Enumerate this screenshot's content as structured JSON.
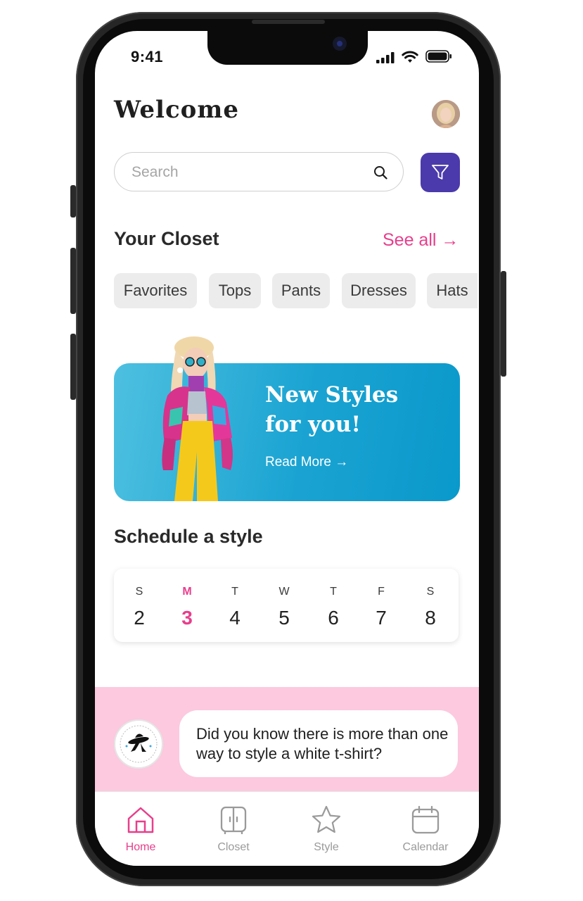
{
  "status_bar": {
    "time": "9:41"
  },
  "header": {
    "title": "Welcome"
  },
  "search": {
    "placeholder": "Search"
  },
  "closet": {
    "title": "Your Closet",
    "see_all": "See all →",
    "categories": [
      "Favorites",
      "Tops",
      "Pants",
      "Dresses",
      "Hats"
    ]
  },
  "banner": {
    "title_line1": "New Styles",
    "title_line2": "for you!",
    "link": "Read More →"
  },
  "schedule": {
    "title": "Schedule a style",
    "days": [
      {
        "name": "S",
        "date": "2"
      },
      {
        "name": "M",
        "date": "3"
      },
      {
        "name": "T",
        "date": "4"
      },
      {
        "name": "W",
        "date": "5"
      },
      {
        "name": "T",
        "date": "6"
      },
      {
        "name": "F",
        "date": "7"
      },
      {
        "name": "S",
        "date": "8"
      }
    ],
    "selected_index": 1
  },
  "tip": {
    "text": "Did you know there is more than one way to style a white t-shirt?"
  },
  "tabbar": {
    "items": [
      {
        "label": "Home",
        "icon": "home-icon"
      },
      {
        "label": "Closet",
        "icon": "closet-icon"
      },
      {
        "label": "Style",
        "icon": "star-icon"
      },
      {
        "label": "Calendar",
        "icon": "calendar-icon"
      }
    ],
    "active_index": 0
  },
  "colors": {
    "accent": "#e83e8c",
    "filter_button": "#4b3aab",
    "tip_band": "#fcc9de",
    "banner": "#1aa3d2"
  }
}
